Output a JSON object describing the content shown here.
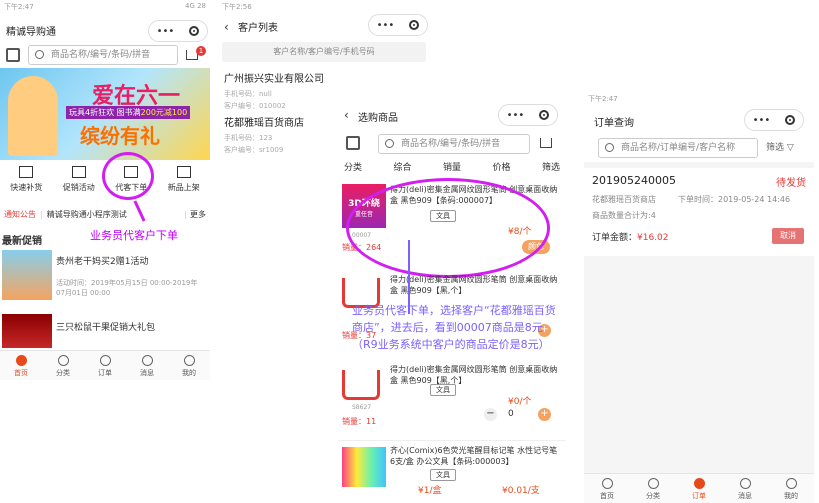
{
  "p1": {
    "status": "下午2:47",
    "status_right": "4G 28",
    "title": "精诚导购通",
    "search": "商品名称/编号/条码/拼音",
    "cart_badge": "1",
    "banner": {
      "big": "爱在六一",
      "line2": "缤纷有礼",
      "promo": "满200元减100",
      "gift": "玩具4折狂欢 图书满",
      "red": "200元减100"
    },
    "menu": [
      "快速补货",
      "促销活动",
      "代客下单",
      "新品上架"
    ],
    "notice_tag": "通知公告",
    "notice_text": "精诚导购通小程序测试",
    "notice_more": "更多",
    "annotation": "业务员代客户下单",
    "section": "最新促销",
    "promos": [
      {
        "title": "贵州老干妈买2赠1活动",
        "time": "活动时间：2019年05月15日 00:00-2019年07月01日 00:00"
      },
      {
        "title": "三只松鼠干果促销大礼包",
        "time": ""
      }
    ],
    "tabs": [
      "首页",
      "分类",
      "订单",
      "消息",
      "我的"
    ]
  },
  "p2": {
    "status": "下午2:56",
    "title": "客户列表",
    "search": "客户名称/客户编号/手机号码",
    "customers": [
      {
        "name": "广州振兴实业有限公司",
        "phone": "手机号码：null",
        "code": "客户编号：010002"
      },
      {
        "name": "花都雅瑶百货商店",
        "phone": "手机号码：123",
        "code": "客户编号：sr1009"
      }
    ]
  },
  "p3": {
    "title": "选购商品",
    "search": "商品名称/编号/条码/拼音",
    "filters": [
      "分类",
      "综合",
      "销量",
      "价格",
      "筛选"
    ],
    "items": [
      {
        "title": "得力(deli)密集金属网纹圆形笔筒 创意桌面收纳盒 黑色909【条码:000007】",
        "tag": "文具",
        "price": "¥8/个",
        "sales": "销量：264",
        "code": "00007",
        "btn": "颜色",
        "img_big": "3D环绕",
        "img_small": "重任音"
      },
      {
        "title": "得力(deli)密集金属网纹圆形笔筒 创意桌面收纳盒 黑色909【黑,个】",
        "tag": "",
        "price": "¥0/个",
        "sales": "销量：37",
        "code": "",
        "btn": ""
      },
      {
        "title": "得力(deli)密集金属网纹圆形笔筒 创意桌面收纳盒 黑色909【黑,个】",
        "tag": "文具",
        "price": "¥0/个",
        "sales": "销量：11",
        "code": "S8627",
        "qty": "0"
      },
      {
        "title": "齐心(Comix)6色荧光笔醒目标记笔 水性记号笔 6支/盒 办公文具【条码:000003】",
        "tag": "文具",
        "price": "¥1/盒",
        "price2": "¥0.01/支",
        "sales": "",
        "code": "",
        "qty": ""
      }
    ],
    "annotation": "业务员代客下单，选择客户“花都雅瑶百货商店”，进去后，看到00007商品是8元（R9业务系统中客户的商品定价是8元）"
  },
  "p4": {
    "status": "下午2:47",
    "title": "订单查询",
    "search": "商品名称/订单编号/客户名称",
    "filter": "筛选",
    "order": {
      "no": "201905240005",
      "status": "待发货",
      "customer": "花都雅瑶百货商店",
      "time": "下单时间：2019-05-24 14:46",
      "qty": "商品数量合计为:4",
      "amount_label": "订单金额：",
      "amount": "¥16.02",
      "cancel": "取消"
    },
    "tabs": [
      "首页",
      "分类",
      "订单",
      "消息",
      "我的"
    ]
  }
}
